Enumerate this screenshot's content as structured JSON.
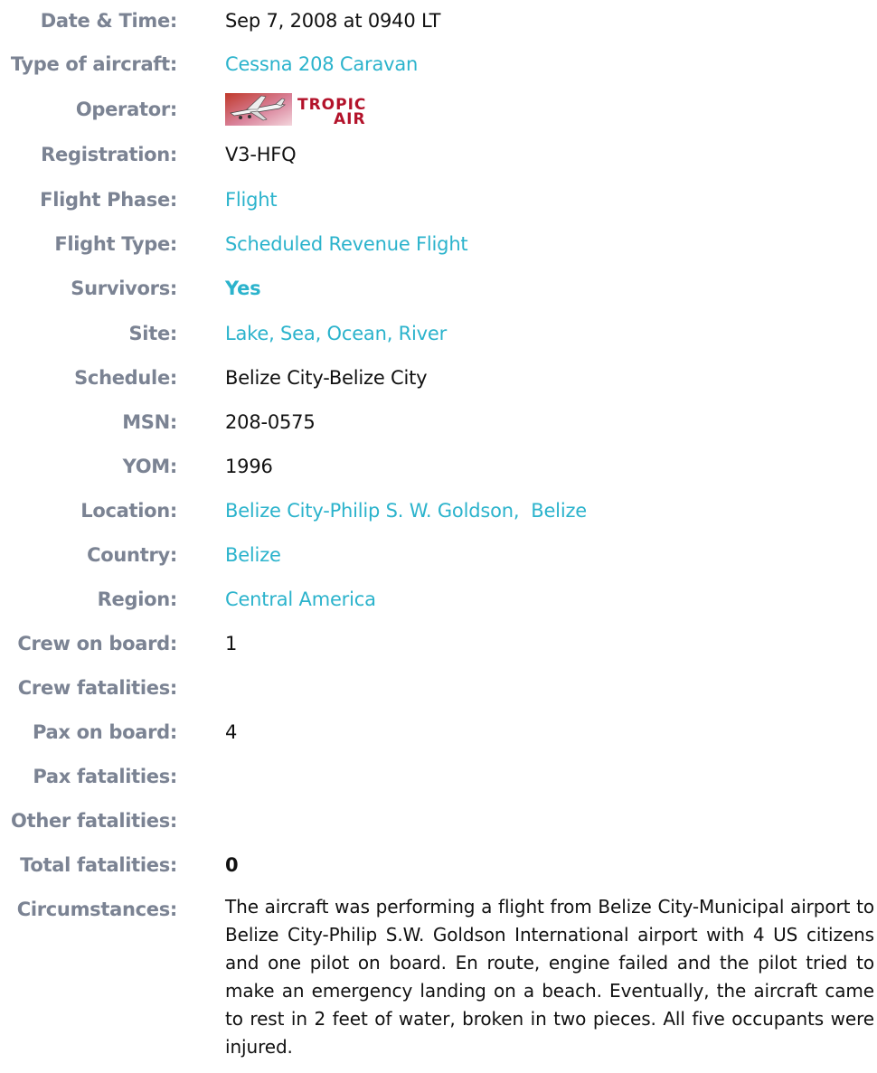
{
  "rows": {
    "date": {
      "label": "Date & Time:",
      "value": "Sep 7, 2008 at 0940 LT"
    },
    "aircraft": {
      "label": "Type of aircraft:",
      "value": "Cessna 208 Caravan"
    },
    "operator": {
      "label": "Operator:",
      "logo_text_top": "TROPIC",
      "logo_text_bottom": "AIR",
      "logo_color": "#b3122a"
    },
    "registration": {
      "label": "Registration:",
      "value": "V3-HFQ"
    },
    "phase": {
      "label": "Flight Phase:",
      "value": "Flight"
    },
    "type": {
      "label": "Flight Type:",
      "value": "Scheduled Revenue Flight"
    },
    "survivors": {
      "label": "Survivors:",
      "value": "Yes"
    },
    "site": {
      "label": "Site:",
      "value": "Lake, Sea, Ocean, River"
    },
    "schedule": {
      "label": "Schedule:",
      "value": "Belize City-Belize City"
    },
    "msn": {
      "label": "MSN:",
      "value": "208-0575"
    },
    "yom": {
      "label": "YOM:",
      "value": "1996"
    },
    "location": {
      "label": "Location:",
      "value": "Belize City-Philip S. W. Goldson,  Belize"
    },
    "country": {
      "label": "Country:",
      "value": "Belize"
    },
    "region": {
      "label": "Region:",
      "value": "Central America"
    },
    "crew_board": {
      "label": "Crew on board:",
      "value": "1"
    },
    "crew_fat": {
      "label": "Crew fatalities:",
      "value": ""
    },
    "pax_board": {
      "label": "Pax on board:",
      "value": "4"
    },
    "pax_fat": {
      "label": "Pax fatalities:",
      "value": ""
    },
    "other_fat": {
      "label": "Other fatalities:",
      "value": ""
    },
    "total_fat": {
      "label": "Total fatalities:",
      "value": "0"
    },
    "circumstances": {
      "label": "Circumstances:",
      "value": "The aircraft was performing a flight from Belize City-Municipal airport to Belize City-Philip S.W. Goldson International airport with 4 US citizens and one pilot on board. En route, engine failed and the pilot tried to make an emergency landing on a beach. Eventually, the aircraft came to rest in 2 feet of water, broken in two pieces. All five occupants were injured."
    }
  },
  "colors": {
    "label": "#7b8393",
    "link": "#2bb3cc",
    "text": "#111111"
  }
}
